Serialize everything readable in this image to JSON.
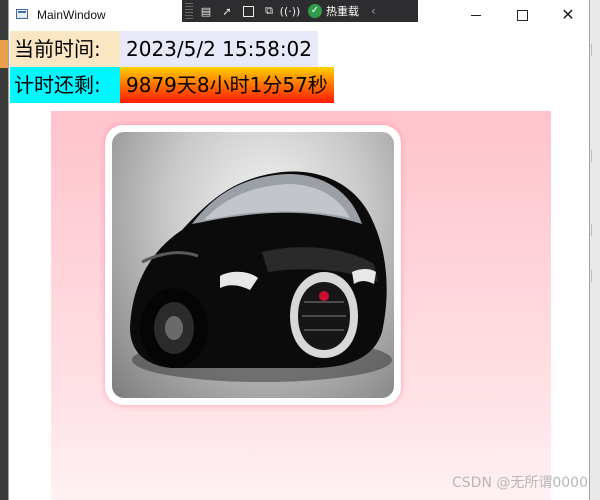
{
  "window": {
    "title": "MainWindow"
  },
  "devtools": {
    "hot_reload_label": "热重载",
    "collapse_glyph": "‹"
  },
  "rows": {
    "current_time_label": "当前时间:",
    "current_time_value": "2023/5/2 15:58:02",
    "remaining_label": "计时还剩:",
    "remaining_value": "9879天8小时1分57秒"
  },
  "watermark": {
    "text": "CSDN @无所谓0000"
  },
  "colors": {
    "label1_bg": "#fbe6c4",
    "label2_bg": "#00f7ff",
    "value1_bg": "#e7e9f8",
    "panel_top": "#ffc3cc",
    "accent_green": "#2e9c4a"
  }
}
